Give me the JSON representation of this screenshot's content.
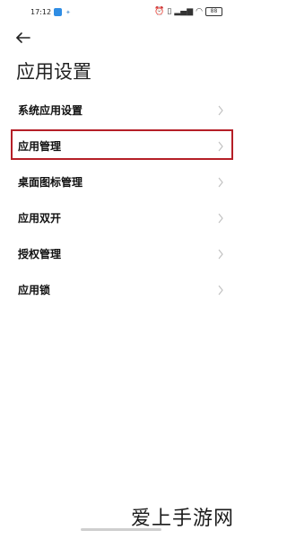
{
  "status_bar": {
    "time": "17:12",
    "battery": "88"
  },
  "header": {
    "title": "应用设置"
  },
  "settings": {
    "items": [
      {
        "label": "系统应用设置"
      },
      {
        "label": "应用管理"
      },
      {
        "label": "桌面图标管理"
      },
      {
        "label": "应用双开"
      },
      {
        "label": "授权管理"
      },
      {
        "label": "应用锁"
      }
    ],
    "highlighted_index": 1
  },
  "watermark": {
    "text": "爱上手游网"
  },
  "colors": {
    "highlight_border": "#b51f27",
    "chevron": "#c2c2c2"
  }
}
